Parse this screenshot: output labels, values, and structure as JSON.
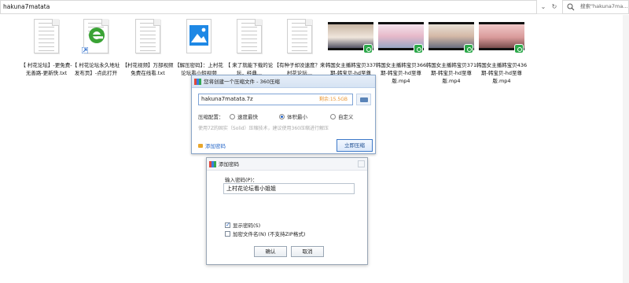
{
  "explorer": {
    "address": "hakuna7matata",
    "search_placeholder": "搜索\"hakuna7ma...",
    "files": [
      {
        "kind": "doc",
        "label": "【 村花论坛】-更免费-无善路-更新快.txt"
      },
      {
        "kind": "ie",
        "label": "【 村花论坛永久地址发布页】-点此打开"
      },
      {
        "kind": "doc",
        "label": "【村花视频】万部视频免费在线看.txt"
      },
      {
        "kind": "pic",
        "label": "【解压密码】：上村花论坛看小短视频"
      },
      {
        "kind": "doc",
        "label": "【 来了就能下载的论坛，经典..."
      },
      {
        "kind": "doc",
        "label": "【有种子却没速度？来村花论坛..."
      },
      {
        "kind": "video",
        "label": "韩国女主播韩宝贝337期-韩宝贝-hd至尊版.mp4"
      },
      {
        "kind": "video",
        "label": "韩国女主播韩宝贝366期-韩宝贝-hd至尊版.mp4"
      },
      {
        "kind": "video",
        "label": "韩国女主播韩宝贝371期-韩宝贝-hd至尊版.mp4"
      },
      {
        "kind": "video",
        "label": "韩国女主播韩宝贝436期-韩宝贝-hd至尊版.mp4"
      }
    ]
  },
  "zip_dialog": {
    "title": "您将创建一个压缩文件 - 360压缩",
    "filename": "hakuna7matata.7z",
    "size_text": "剩余:15.5GB",
    "config_label": "压缩配置：",
    "options": [
      "速度最快",
      "体积最小",
      "自定义"
    ],
    "selected_option": "体积最小",
    "hint": "使用7Z的固实（Solid）压缩技术，建议使用360压缩进行解压",
    "add_password": "添加密码",
    "compress_button": "立即压缩"
  },
  "password_dialog": {
    "title": "添加密码",
    "input_label": "输入密码(P)：",
    "password_value": "上村花论坛看小姐姐",
    "show_password": "显示密码(S)",
    "show_password_checked": true,
    "encrypt_names": "加密文件名(N) (不支持ZIP格式)",
    "encrypt_names_checked": false,
    "ok_button": "确认",
    "cancel_button": "取消"
  }
}
